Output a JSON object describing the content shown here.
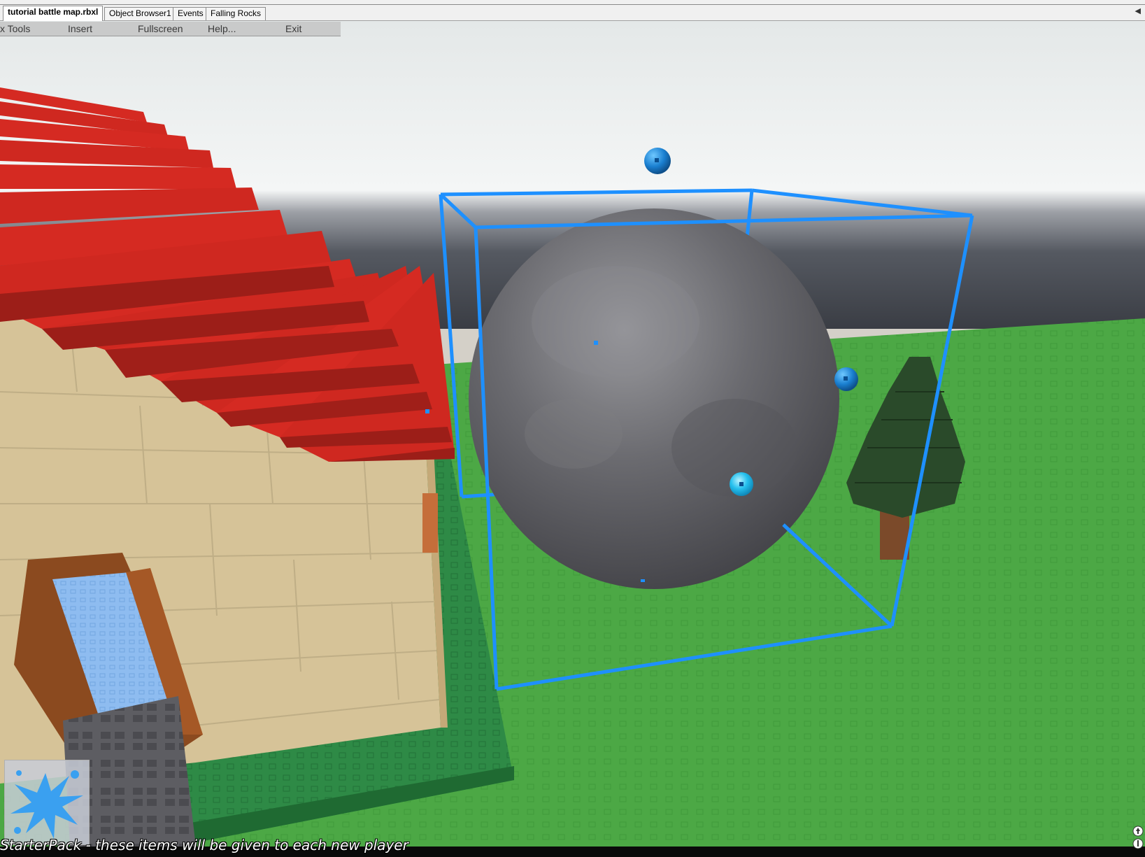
{
  "tabs": [
    {
      "label": "tutorial battle map.rbxl",
      "active": true
    },
    {
      "label": "Object Browser1",
      "active": false
    },
    {
      "label": "Events",
      "active": false
    },
    {
      "label": "Falling Rocks",
      "active": false
    }
  ],
  "menu": {
    "items": [
      "x Tools",
      "Insert",
      "Fullscreen",
      "Help...",
      "Exit"
    ]
  },
  "scene": {
    "objects": [
      "house",
      "red-roof",
      "rock-sphere",
      "selection-box",
      "pine-tree",
      "green-baseplate"
    ],
    "colors": {
      "roof": "#cc2a22",
      "wall": "#d8c59a",
      "grass": "#4ca845",
      "selection": "#1e90ff",
      "rock": "#6e6e72",
      "tree": "#2a4a2a",
      "sky_top": "#e9ecec",
      "horizon": "#3a3d44"
    }
  },
  "starterpack": {
    "icon": "paint-splat-icon"
  },
  "status": {
    "message": "StarterPack - these items will be given to each new player"
  }
}
